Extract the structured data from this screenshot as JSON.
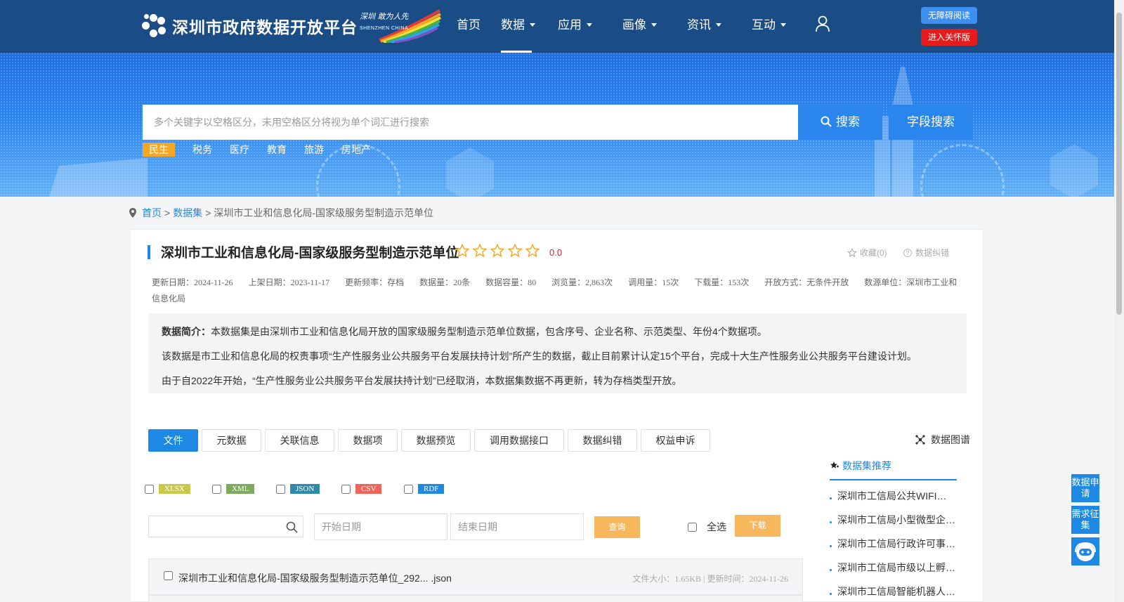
{
  "header": {
    "logo_title": "深圳市政府数据开放平台",
    "brand_text": "深圳 敢为人先",
    "brand_sub": "SHENZHEN CHINA",
    "nav": [
      {
        "label": "首页",
        "dropdown": false
      },
      {
        "label": "数据",
        "dropdown": true,
        "active": true
      },
      {
        "label": "应用",
        "dropdown": true
      },
      {
        "label": "画像",
        "dropdown": true
      },
      {
        "label": "资讯",
        "dropdown": true
      },
      {
        "label": "互动",
        "dropdown": true
      }
    ],
    "user_icon": "user-icon",
    "accessibility_label": "无障碍阅读",
    "care_mode_label": "进入关怀版"
  },
  "search": {
    "placeholder": "多个关键字以空格区分，未用空格区分将视为单个词汇进行搜索",
    "search_label": "搜索",
    "field_search_label": "字段搜索",
    "hot_tags": [
      "民生",
      "税务",
      "医疗",
      "教育",
      "旅游",
      "房地产"
    ]
  },
  "breadcrumb": {
    "home": "首页",
    "datasets": "数据集",
    "current": "深圳市工业和信息化局-国家级服务型制造示范单位",
    "separator": ">"
  },
  "dataset": {
    "title": "深圳市工业和信息化局-国家级服务型制造示范单位",
    "rating_stars": 0,
    "rating_max": 5,
    "score": "0.0",
    "favorite_label": "收藏(0)",
    "correction_label": "数据纠错",
    "meta": [
      "更新日期：2024-11-26",
      "上架日期：2023-11-17",
      "更新频率：存档",
      "数据量：20条",
      "数据容量：80",
      "浏览量：2,863次",
      "调用量：15次",
      "下载量：153次",
      "开放方式：无条件开放",
      "数源单位：深圳市工业和信息化局"
    ],
    "intro_label": "数据简介：",
    "intro_lines": [
      "本数据集是由深圳市工业和信息化局开放的国家级服务型制造示范单位数据，包含序号、企业名称、示范类型、年份4个数据项。",
      "该数据是市工业和信息化局的权责事项“生产性服务业公共服务平台发展扶持计划”所产生的数据，截止目前累计认定15个平台，完成十大生产性服务业公共服务平台建设计划。",
      "由于自2022年开始，“生产性服务业公共服务平台发展扶持计划”已经取消，本数据集数据不再更新，转为存档类型开放。"
    ]
  },
  "tabs": [
    "文件",
    "元数据",
    "关联信息",
    "数据项",
    "数据预览",
    "调用数据接口",
    "数据纠错",
    "权益申诉"
  ],
  "graph_label": "数据图谱",
  "formats": [
    {
      "label": "XLSX",
      "color": "#c8c84a"
    },
    {
      "label": "XML",
      "color": "#7cab5c"
    },
    {
      "label": "JSON",
      "color": "#2e8aa8"
    },
    {
      "label": "CSV",
      "color": "#f0645a"
    },
    {
      "label": "RDF",
      "color": "#1e88e5"
    }
  ],
  "filters": {
    "start_placeholder": "开始日期",
    "end_placeholder": "结束日期",
    "query_label": "查询",
    "select_all_label": "全选",
    "download_label": "下载"
  },
  "files": [
    {
      "name": "深圳市工业和信息化局-国家级服务型制造示范单位_292... .json",
      "info": "文件大小：1.65KB | 更新时间：2024-11-26"
    }
  ],
  "recommend": {
    "title": "数据集推荐",
    "items": [
      "深圳市工信局公共WIFI…",
      "深圳市工信局小型微型企…",
      "深圳市工信局行政许可事…",
      "深圳市工信局市级以上孵…",
      "深圳市工信局智能机器人…"
    ]
  },
  "floating": {
    "apply_label": "数据申请",
    "demand_label": "需求征集",
    "bot_icon": "robot-icon"
  }
}
